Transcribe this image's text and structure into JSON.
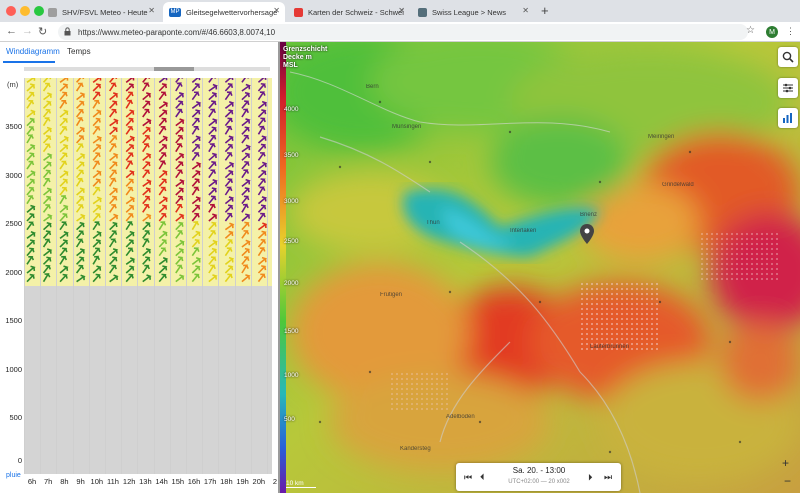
{
  "browser": {
    "tabs": [
      {
        "title": "SHV/FSVL Meteo - Heute",
        "favicon_color": "#9e9e9e",
        "active": false
      },
      {
        "title": "Gleitsegelwettervorhersage | M",
        "favicon_color": "#1565c0",
        "favicon_text": "MP",
        "active": true
      },
      {
        "title": "Karten der Schweiz - Schweize",
        "favicon_color": "#e53935",
        "active": false
      },
      {
        "title": "Swiss League > News",
        "favicon_color": "#546e7a",
        "active": false
      }
    ],
    "url": "https://www.meteo-paraponte.com/#/46.6603,8.0074,10",
    "profile_initial": "M"
  },
  "panel": {
    "tabs": [
      "Winddiagramm",
      "Temps"
    ],
    "y_unit": "(m)",
    "y_ticks": [
      "3500",
      "3000",
      "2500",
      "2000",
      "1500",
      "1000",
      "500",
      "0"
    ],
    "x_ticks": [
      "6h",
      "7h",
      "8h",
      "9h",
      "10h",
      "11h",
      "12h",
      "13h",
      "14h",
      "15h",
      "16h",
      "17h",
      "18h",
      "19h",
      "20h",
      "2"
    ],
    "rain_label": "pluie"
  },
  "map": {
    "legend_title": "Grenzschicht Decke m MSL",
    "legend_levels": [
      "4000",
      "3500",
      "3000",
      "2500",
      "2000",
      "1500",
      "1000",
      "500"
    ],
    "places": [
      "Bern",
      "Thun",
      "Interlaken",
      "Münsingen",
      "Brienz",
      "Meiringen",
      "Frutigen",
      "Adelboden",
      "Grindelwald",
      "Lauterbrunnen",
      "Kandersteg"
    ],
    "scale": "10 km",
    "time_label": "Sa. 20. - 13:00",
    "time_sub": "UTC+02:00 — 20 x002"
  }
}
